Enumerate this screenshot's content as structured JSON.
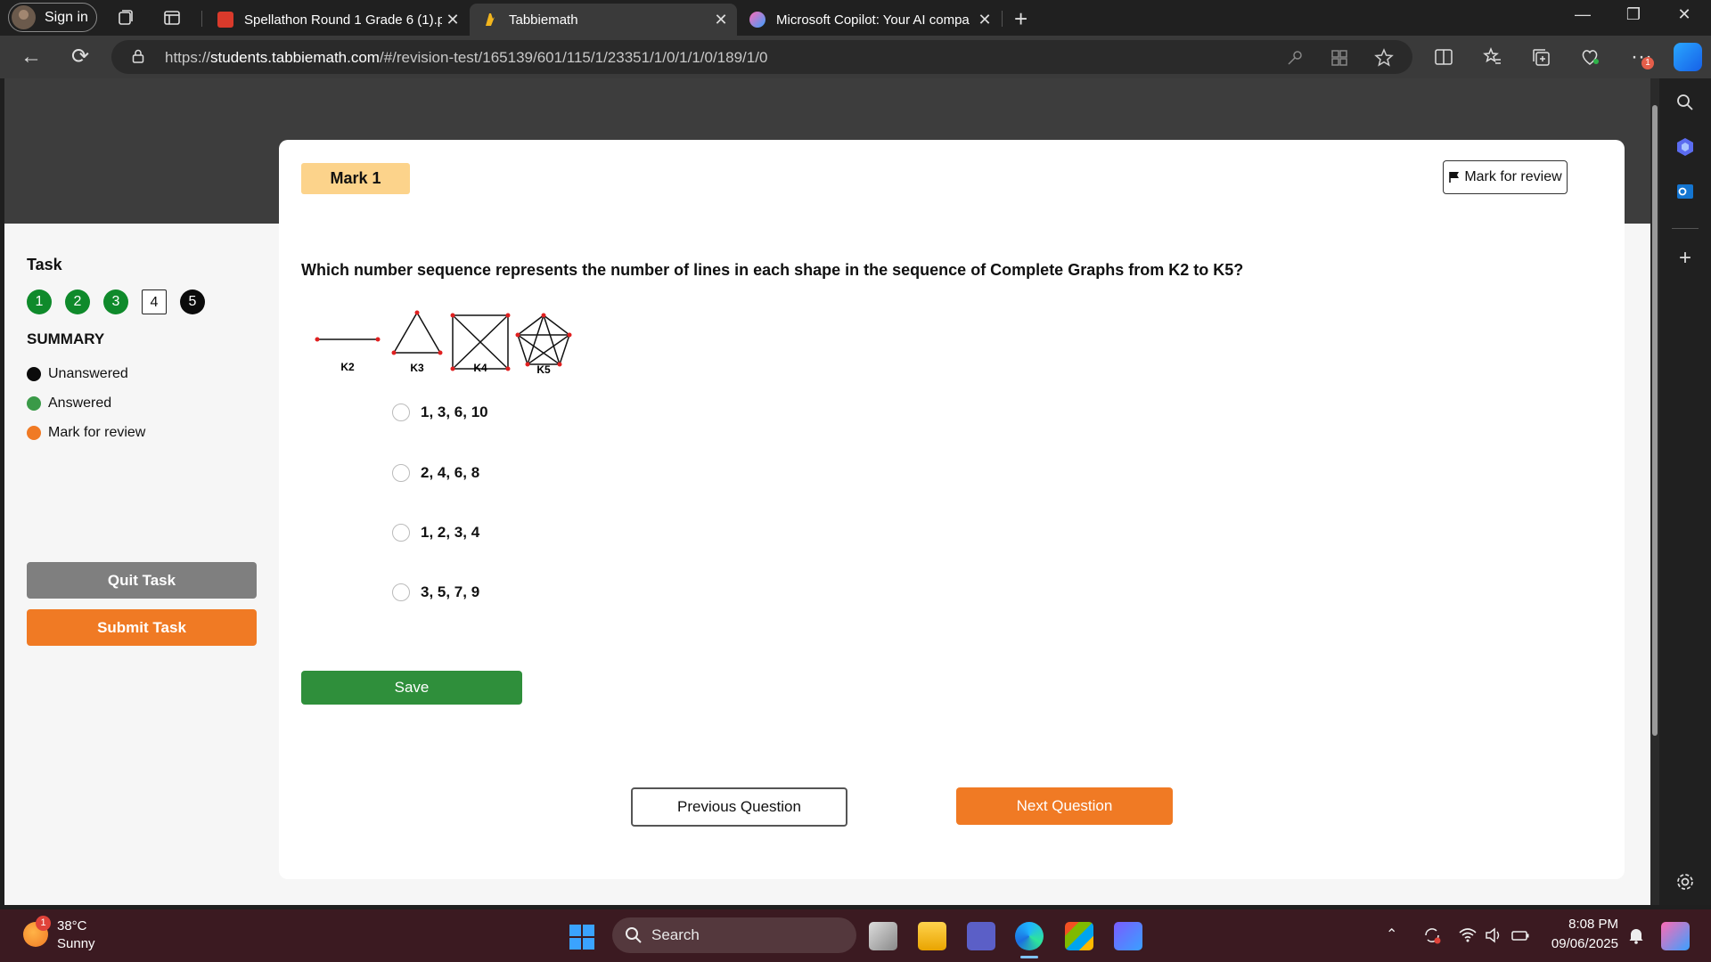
{
  "browser": {
    "signin_label": "Sign in",
    "tabs": [
      {
        "title": "Spellathon Round 1 Grade 6 (1).p",
        "favicon": "pdf-icon",
        "active": false
      },
      {
        "title": "Tabbiemath",
        "favicon": "tabbiemath-icon",
        "active": true
      },
      {
        "title": "Microsoft Copilot: Your AI compa",
        "favicon": "copilot-icon",
        "active": false
      }
    ],
    "url_prefix": "https://",
    "url_host": "students.tabbiemath.com",
    "url_path": "/#/revision-test/165139/601/115/1/23351/1/0/1/1/0/189/1/0",
    "notification_count": "1"
  },
  "sidebar": {
    "task_title": "Task",
    "questions": [
      {
        "num": "1",
        "state": "answered"
      },
      {
        "num": "2",
        "state": "answered"
      },
      {
        "num": "3",
        "state": "answered"
      },
      {
        "num": "4",
        "state": "current"
      },
      {
        "num": "5",
        "state": "unanswered"
      }
    ],
    "summary_title": "SUMMARY",
    "legend": [
      {
        "label": "Unanswered",
        "color": "#0b0b0b"
      },
      {
        "label": "Answered",
        "color": "#3a9a48"
      },
      {
        "label": "Mark for review",
        "color": "#f07a24"
      }
    ],
    "quit_label": "Quit Task",
    "submit_label": "Submit Task"
  },
  "question": {
    "mark_label": "Mark 1",
    "review_label": "Mark for review",
    "text": "Which number sequence represents the number of lines in each shape in the sequence of Complete Graphs from K2 to K5?",
    "graph_labels": [
      "K2",
      "K3",
      "K4",
      "K5"
    ],
    "options": [
      "1, 3, 6, 10",
      "2, 4, 6, 8",
      "1, 2, 3, 4",
      "3, 5, 7, 9"
    ],
    "save_label": "Save",
    "prev_label": "Previous Question",
    "next_label": "Next Question"
  },
  "taskbar": {
    "weather_badge": "1",
    "temperature": "38°C",
    "condition": "Sunny",
    "search_placeholder": "Search",
    "time": "8:08 PM",
    "date": "09/06/2025"
  },
  "colors": {
    "accent_orange": "#f07a24",
    "answered_green": "#0f8a2b",
    "save_green": "#2f8f3b",
    "mark_chip": "#fcd38b"
  }
}
